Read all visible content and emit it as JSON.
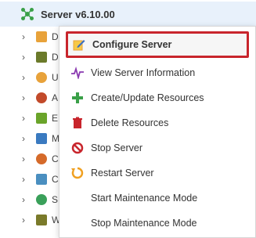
{
  "tree": {
    "header_title": "Server v6.10.00",
    "rows": [
      {
        "label": "D",
        "color": "#e8a23a"
      },
      {
        "label": "D",
        "color": "#6b7a2a"
      },
      {
        "label": "U",
        "color": "#e8a23a"
      },
      {
        "label": "A",
        "color": "#c24a2a"
      },
      {
        "label": "E",
        "color": "#6aa42a"
      },
      {
        "label": "M",
        "color": "#3a7ac0"
      },
      {
        "label": "C",
        "color": "#d56a2a"
      },
      {
        "label": "C",
        "color": "#4a8fc0"
      },
      {
        "label": "S",
        "color": "#3aa05a"
      },
      {
        "label": "W",
        "color": "#7a7a2a"
      }
    ]
  },
  "menu": {
    "items": [
      {
        "label": "Configure Server",
        "icon": "edit-icon",
        "color": "#e8a23a"
      },
      {
        "label": "View Server Information",
        "icon": "pulse-icon",
        "color": "#8a3ab0"
      },
      {
        "label": "Create/Update Resources",
        "icon": "plus-icon",
        "color": "#3aa048"
      },
      {
        "label": "Delete Resources",
        "icon": "trash-icon",
        "color": "#c8252c"
      },
      {
        "label": "Stop Server",
        "icon": "stop-icon",
        "color": "#c8252c"
      },
      {
        "label": "Restart Server",
        "icon": "restart-icon",
        "color": "#f0a020"
      },
      {
        "label": "Start Maintenance Mode",
        "icon": "",
        "color": ""
      },
      {
        "label": "Stop Maintenance Mode",
        "icon": "",
        "color": ""
      }
    ]
  }
}
